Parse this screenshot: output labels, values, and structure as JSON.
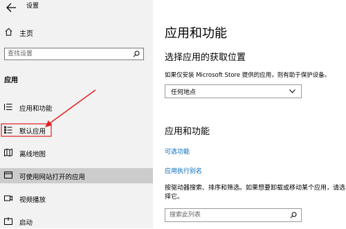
{
  "window": {
    "title": "设置"
  },
  "sidebar": {
    "home_label": "主页",
    "search_placeholder": "查找设置",
    "section_label": "应用",
    "items": [
      {
        "label": "应用和功能",
        "icon": "list-icon"
      },
      {
        "label": "默认应用",
        "icon": "default-apps-icon"
      },
      {
        "label": "离线地图",
        "icon": "map-icon"
      },
      {
        "label": "可使用网站打开的应用",
        "icon": "web-app-icon",
        "selected": true
      },
      {
        "label": "视频播放",
        "icon": "video-icon"
      },
      {
        "label": "启动",
        "icon": "startup-icon"
      }
    ]
  },
  "main": {
    "title": "应用和功能",
    "install_heading": "选择应用的获取位置",
    "install_desc": "如果仅安装 Microsoft Store 提供的应用，则有助于保护设备。",
    "install_dropdown_value": "任何地点",
    "apps_heading": "应用和功能",
    "optional_features_link": "可选功能",
    "aliases_link": "应用执行别名",
    "search_desc": "按驱动器搜索、排序和筛选。如果想要卸载或移动某个应用，请选择它。",
    "search_placeholder": "搜索此列表"
  },
  "colors": {
    "accent": "#0078d7",
    "link": "#0067b8",
    "annotation_arrow": "#e02020",
    "sidebar_bg": "#f2f2f2",
    "selected_bg": "#cccccc"
  }
}
